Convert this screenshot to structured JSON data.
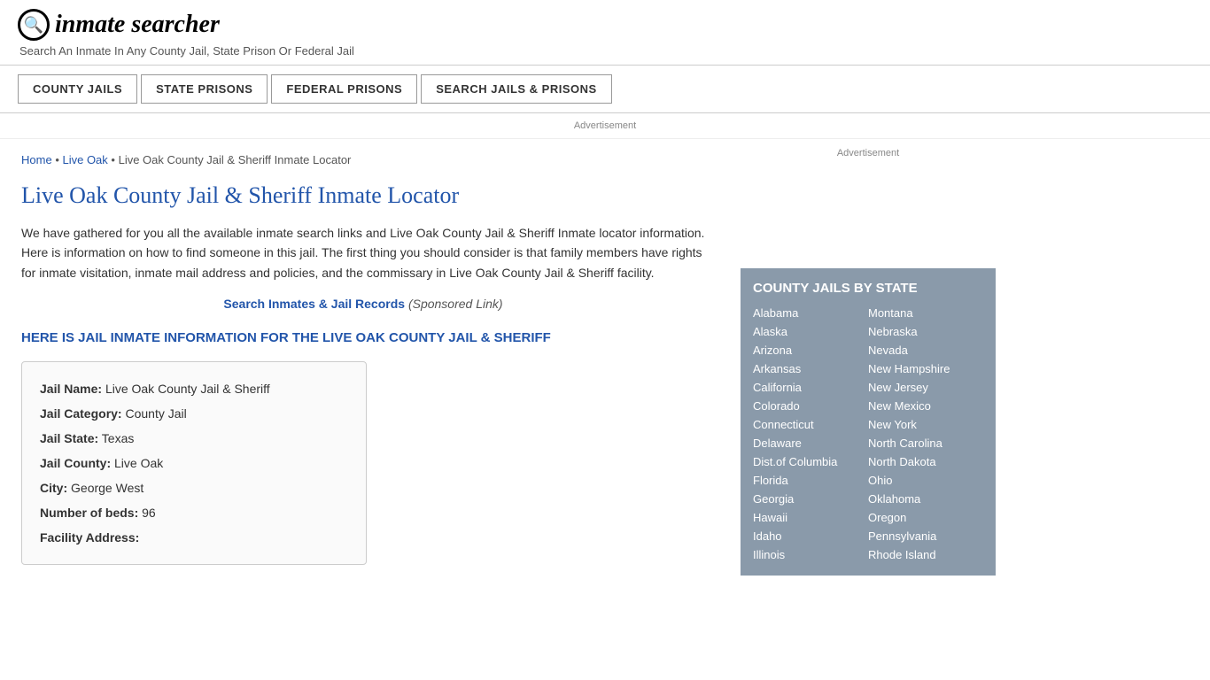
{
  "header": {
    "logo_icon": "Q",
    "logo_text": "inmate searcher",
    "tagline": "Search An Inmate In Any County Jail, State Prison Or Federal Jail"
  },
  "nav": {
    "buttons": [
      {
        "label": "COUNTY JAILS",
        "name": "county-jails-btn"
      },
      {
        "label": "STATE PRISONS",
        "name": "state-prisons-btn"
      },
      {
        "label": "FEDERAL PRISONS",
        "name": "federal-prisons-btn"
      },
      {
        "label": "SEARCH JAILS & PRISONS",
        "name": "search-jails-btn"
      }
    ]
  },
  "ad_bar": "Advertisement",
  "breadcrumb": {
    "home": "Home",
    "live_oak": "Live Oak",
    "current": "Live Oak County Jail & Sheriff Inmate Locator"
  },
  "page_title": "Live Oak County Jail & Sheriff Inmate Locator",
  "description": "We have gathered for you all the available inmate search links and Live Oak County Jail & Sheriff Inmate locator information. Here is information on how to find someone in this jail. The first thing you should consider is that family members have rights for inmate visitation, inmate mail address and policies, and the commissary in Live Oak County Jail & Sheriff facility.",
  "search_link": {
    "text": "Search Inmates & Jail Records",
    "sponsored": "(Sponsored Link)"
  },
  "inmate_info_heading": "HERE IS JAIL INMATE INFORMATION FOR THE LIVE OAK COUNTY JAIL & SHERIFF",
  "info_box": {
    "jail_name_label": "Jail Name:",
    "jail_name_value": "Live Oak County Jail & Sheriff",
    "jail_category_label": "Jail Category:",
    "jail_category_value": "County Jail",
    "jail_state_label": "Jail State:",
    "jail_state_value": "Texas",
    "jail_county_label": "Jail County:",
    "jail_county_value": "Live Oak",
    "city_label": "City:",
    "city_value": "George West",
    "num_beds_label": "Number of beds:",
    "num_beds_value": "96",
    "facility_address_label": "Facility Address:"
  },
  "sidebar": {
    "ad_label": "Advertisement",
    "state_box_title": "COUNTY JAILS BY STATE",
    "states_left": [
      "Alabama",
      "Alaska",
      "Arizona",
      "Arkansas",
      "California",
      "Colorado",
      "Connecticut",
      "Delaware",
      "Dist.of Columbia",
      "Florida",
      "Georgia",
      "Hawaii",
      "Idaho",
      "Illinois"
    ],
    "states_right": [
      "Montana",
      "Nebraska",
      "Nevada",
      "New Hampshire",
      "New Jersey",
      "New Mexico",
      "New York",
      "North Carolina",
      "North Dakota",
      "Ohio",
      "Oklahoma",
      "Oregon",
      "Pennsylvania",
      "Rhode Island"
    ]
  }
}
